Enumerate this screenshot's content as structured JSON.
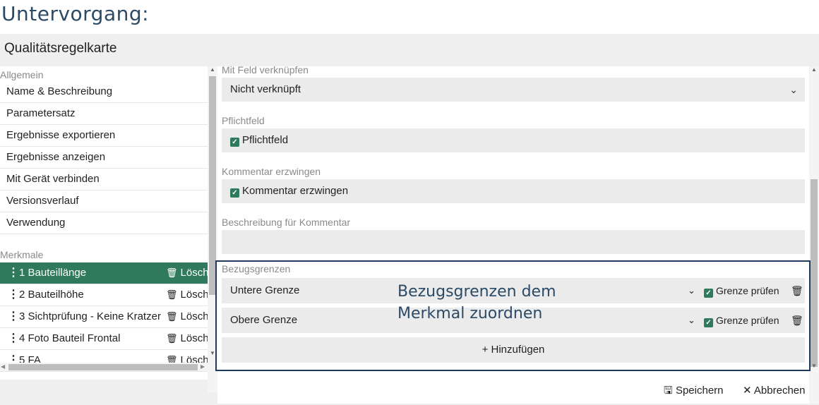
{
  "page_heading": "Untervorgang:",
  "dialog": {
    "title": "Qualitätsregelkarte"
  },
  "sidebar": {
    "general_label": "Allgemein",
    "items": [
      {
        "label": "Name & Beschreibung"
      },
      {
        "label": "Parametersatz"
      },
      {
        "label": "Ergebnisse exportieren"
      },
      {
        "label": "Ergebnisse anzeigen"
      },
      {
        "label": "Mit Gerät verbinden"
      },
      {
        "label": "Versionsverlauf"
      },
      {
        "label": "Verwendung"
      }
    ],
    "features_label": "Merkmale",
    "delete_label": "Lösch",
    "features": [
      {
        "label": "1  Bauteillänge",
        "active": true
      },
      {
        "label": "2  Bauteilhöhe"
      },
      {
        "label": "3  Sichtprüfung - Keine Kratzer"
      },
      {
        "label": "4  Foto Bauteil Frontal"
      },
      {
        "label": "5  FA"
      }
    ]
  },
  "form": {
    "link_field": {
      "label": "Mit Feld verknüpfen",
      "value": "Nicht verknüpft"
    },
    "required": {
      "label": "Pflichtfeld",
      "checkbox_label": "Pflichtfeld",
      "checked": true
    },
    "force_comment": {
      "label": "Kommentar erzwingen",
      "checkbox_label": "Kommentar erzwingen",
      "checked": true
    },
    "comment_description": {
      "label": "Beschreibung für Kommentar",
      "value": ""
    },
    "reference_limits": {
      "label": "Bezugsgrenzen",
      "check_label": "Grenze prüfen",
      "rows": [
        {
          "name": "Untere Grenze",
          "checked": true
        },
        {
          "name": "Obere Grenze",
          "checked": true
        }
      ],
      "add_label": "+ Hinzufügen"
    }
  },
  "callout": {
    "line1": "Bezugsgrenzen dem",
    "line2": "Merkmal zuordnen"
  },
  "footer": {
    "save_label": "Speichern",
    "cancel_label": "Abbrechen"
  },
  "colors": {
    "accent": "#2f7a5c",
    "heading": "#2b4a66",
    "callout_border": "#1e3a5c",
    "field_bg": "#ebebeb",
    "dialog_bg": "#efefef"
  },
  "icons": {
    "drag": "drag-handle-icon",
    "delete": "trash-icon",
    "dropdown": "chevron-down-icon",
    "check": "checkbox-checked-icon",
    "save": "save-icon",
    "cancel": "close-icon"
  }
}
